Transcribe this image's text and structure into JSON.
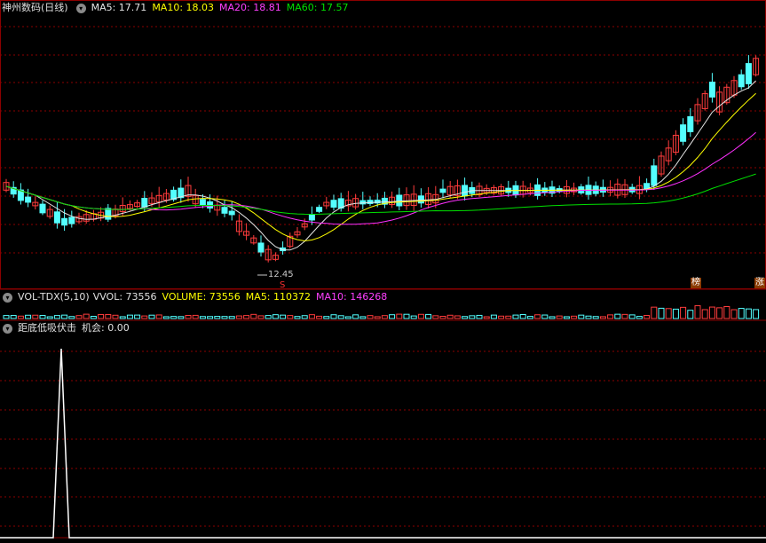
{
  "main_panel": {
    "title": "神州数码(日线)",
    "ma5": "MA5: 17.71",
    "ma10": "MA10: 18.03",
    "ma20": "MA20: 18.81",
    "ma60": "MA60: 17.57",
    "low_marker": "12.45",
    "signal_flag": "S",
    "badge_bang": "榜",
    "badge_zhang": "涨"
  },
  "volume_panel": {
    "indicator": "VOL-TDX(5,10)",
    "vvol": "VVOL: 73556",
    "volume": "VOLUME: 73556",
    "ma5": "MA5: 110372",
    "ma10": "MA10: 146268"
  },
  "signal_panel": {
    "name": "距底低吸伏击",
    "value": "机会: 0.00"
  },
  "colors": {
    "up": "#ff3c3c",
    "down": "#54ffff",
    "ma5": "#e6e6e6",
    "ma10": "#ffff00",
    "ma20": "#ff30ff",
    "ma60": "#00e000",
    "grid": "#8c0000"
  },
  "icons": [
    "chevron-down-icon"
  ]
}
